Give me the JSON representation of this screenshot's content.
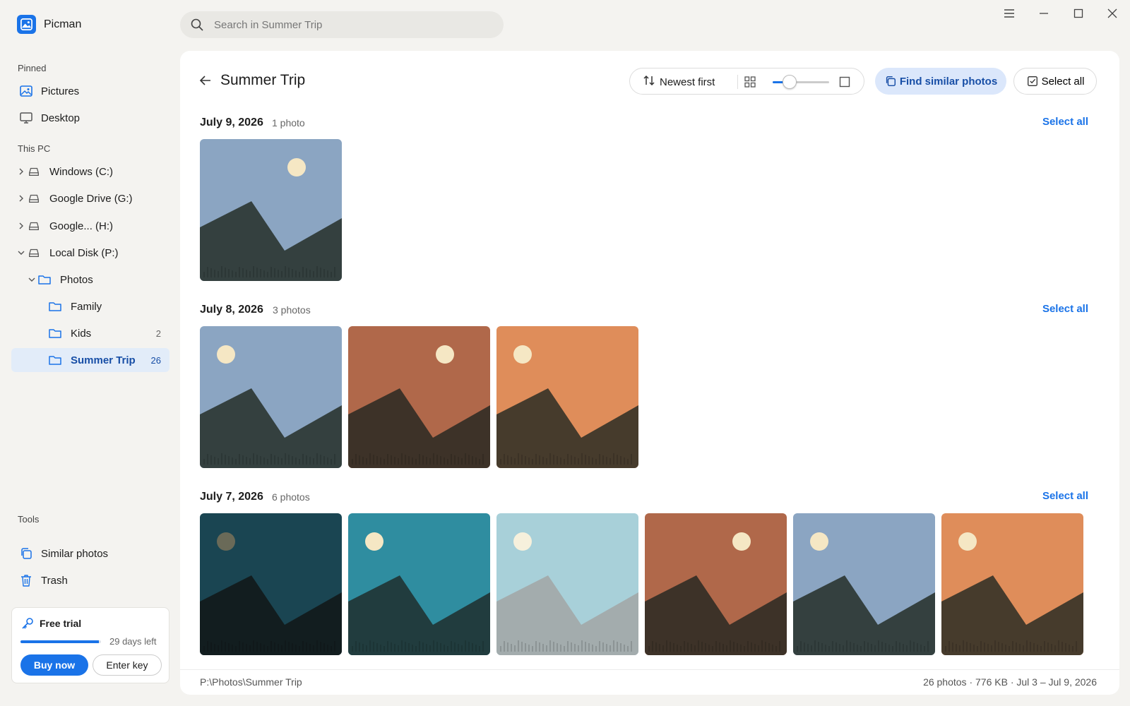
{
  "app": {
    "title": "Picman"
  },
  "search": {
    "placeholder": "Search in Summer Trip"
  },
  "sidebar": {
    "pinned_label": "Pinned",
    "pinned": [
      {
        "label": "Pictures",
        "icon": "image-icon"
      },
      {
        "label": "Desktop",
        "icon": "monitor-icon"
      }
    ],
    "this_pc_label": "This PC",
    "drives": [
      {
        "label": "Windows (C:)",
        "expanded": false
      },
      {
        "label": "Google Drive (G:)",
        "expanded": false
      },
      {
        "label": "Google... (H:)",
        "expanded": false
      },
      {
        "label": "Local Disk (P:)",
        "expanded": true
      }
    ],
    "folders": [
      {
        "label": "Photos",
        "expanded": true,
        "count": ""
      },
      {
        "label": "Family",
        "count": ""
      },
      {
        "label": "Kids",
        "count": "2"
      },
      {
        "label": "Summer Trip",
        "count": "26",
        "active": true
      }
    ],
    "tools_label": "Tools",
    "tools": [
      {
        "label": "Similar photos",
        "icon": "copy-icon"
      },
      {
        "label": "Trash",
        "icon": "trash-icon"
      }
    ],
    "trial": {
      "title": "Free trial",
      "days_left": "29 days left",
      "progress": 0.97,
      "buy_label": "Buy now",
      "key_label": "Enter key"
    }
  },
  "main": {
    "title": "Summer Trip",
    "sort_label": "Newest first",
    "thumb_size_level": 0.3,
    "find_similar_label": "Find similar photos",
    "select_all_label": "Select all",
    "groups": [
      {
        "date": "July 9, 2026",
        "count": "1 photo",
        "select_label": "Select all",
        "photos": [
          {
            "sky": "#8ba5c2",
            "mountain": "#34403f",
            "sun": "#f5e7c4",
            "sun_side": "right"
          }
        ]
      },
      {
        "date": "July 8, 2026",
        "count": "3 photos",
        "select_label": "Select all",
        "photos": [
          {
            "sky": "#8ba5c2",
            "mountain": "#34403f",
            "sun": "#f5e7c4",
            "sun_side": "left"
          },
          {
            "sky": "#b0684a",
            "mountain": "#3d3228",
            "sun": "#f5e7c4",
            "sun_side": "right"
          },
          {
            "sky": "#df8d5a",
            "mountain": "#463b2c",
            "sun": "#f5e7c4",
            "sun_side": "left"
          }
        ]
      },
      {
        "date": "July 7, 2026",
        "count": "6 photos",
        "select_label": "Select all",
        "photos": [
          {
            "sky": "#1a4552",
            "mountain": "#121d1f",
            "sun": "#6a6a58",
            "sun_side": "left"
          },
          {
            "sky": "#2f8da0",
            "mountain": "#213c3e",
            "sun": "#f5e7c4",
            "sun_side": "left"
          },
          {
            "sky": "#a8d0d9",
            "mountain": "#a3acad",
            "sun": "#f6f0dc",
            "sun_side": "left"
          },
          {
            "sky": "#b0684a",
            "mountain": "#3d3228",
            "sun": "#f5e7c4",
            "sun_side": "right"
          },
          {
            "sky": "#8ba5c2",
            "mountain": "#34403f",
            "sun": "#f5e7c4",
            "sun_side": "left"
          },
          {
            "sky": "#df8d5a",
            "mountain": "#463b2c",
            "sun": "#f5e7c4",
            "sun_side": "left"
          }
        ]
      }
    ]
  },
  "status": {
    "path": "P:\\Photos\\Summer Trip",
    "summary": "26 photos · 776 KB · Jul 3 – Jul 9, 2026"
  },
  "colors": {
    "accent": "#1a73e8",
    "active_bg": "#e2ecf9",
    "panel_bg": "#ffffff",
    "app_bg": "#f4f3f0"
  }
}
